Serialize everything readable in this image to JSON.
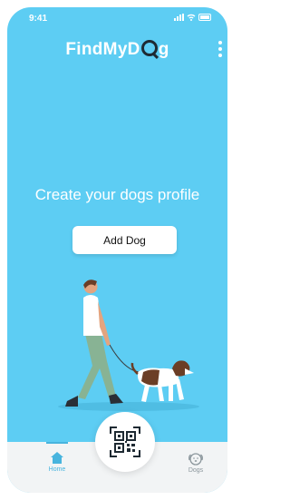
{
  "status_bar": {
    "time": "9:41",
    "icons": [
      "signal-icon",
      "wifi-icon",
      "battery-icon"
    ]
  },
  "header": {
    "logo_prefix": "FindMyD",
    "logo_suffix": "g",
    "menu_icon": "kebab-menu-icon"
  },
  "main": {
    "headline": "Create your dogs profile",
    "add_button_label": "Add Dog",
    "illustration": "man-walking-dog-illustration"
  },
  "bottom_nav": {
    "items": [
      {
        "label": "Home",
        "icon": "home-icon",
        "active": true
      },
      {
        "label": "Dogs",
        "icon": "dog-icon",
        "active": false
      }
    ],
    "scan_icon": "qr-scan-icon"
  },
  "colors": {
    "background": "#5dcdf3",
    "accent": "#48b4de",
    "nav_background": "#f2f4f5"
  }
}
